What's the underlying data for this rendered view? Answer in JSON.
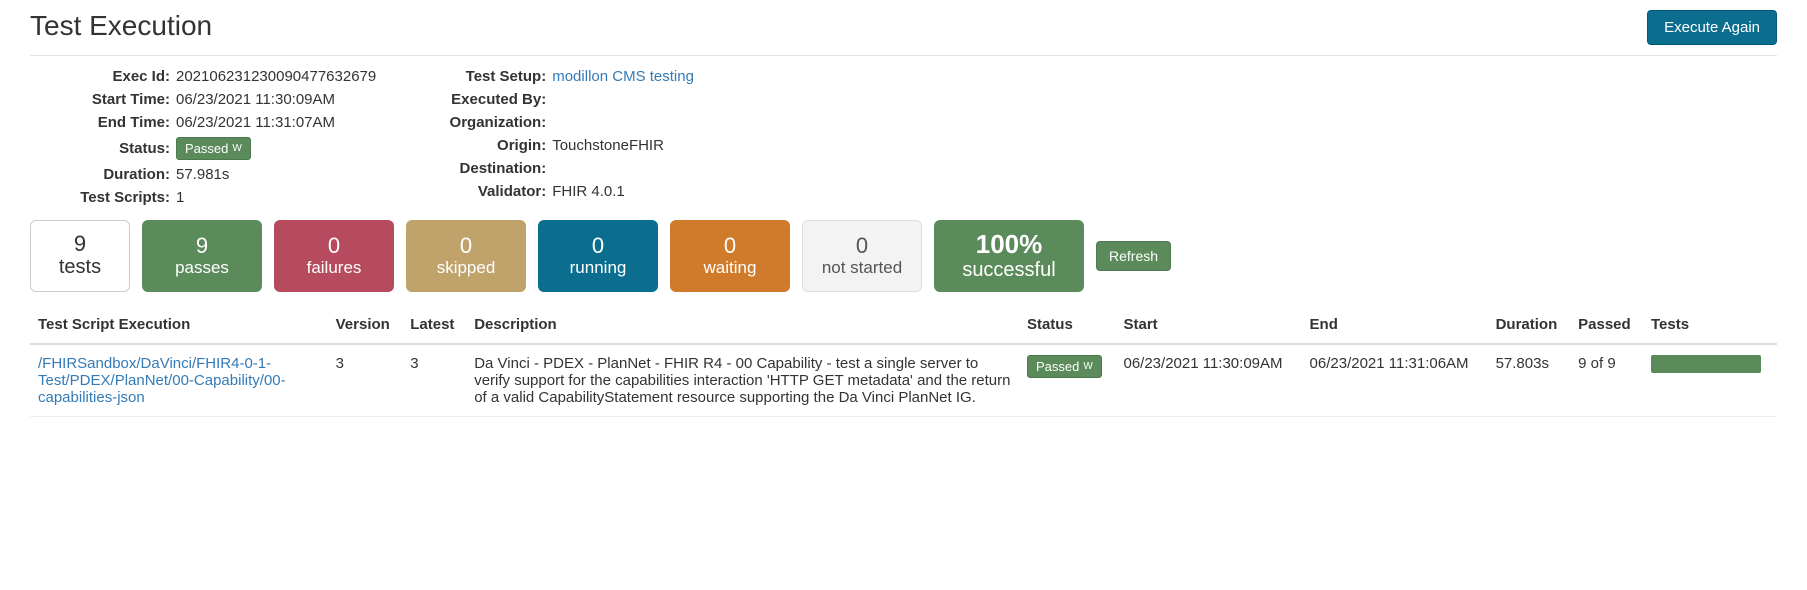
{
  "page": {
    "title": "Test Execution",
    "execute_again": "Execute Again"
  },
  "meta_left": {
    "exec_id_label": "Exec Id:",
    "exec_id": "20210623123009047763​2679",
    "start_label": "Start Time:",
    "start": "06/23/2021 11:30:09AM",
    "end_label": "End Time:",
    "end": "06/23/2021 11:31:07AM",
    "status_label": "Status:",
    "status_badge": "Passed",
    "status_sup": "W",
    "duration_label": "Duration:",
    "duration": "57.981s",
    "scripts_label": "Test Scripts:",
    "scripts": "1"
  },
  "meta_right": {
    "setup_label": "Test Setup:",
    "setup_link": "modillon CMS testing",
    "execby_label": "Executed By:",
    "execby": "",
    "org_label": "Organization:",
    "org": "",
    "origin_label": "Origin:",
    "origin": "TouchstoneFHIR",
    "dest_label": "Destination:",
    "dest": "",
    "validator_label": "Validator:",
    "validator": "FHIR 4.0.1"
  },
  "tiles": {
    "tests_n": "9",
    "tests_l": "tests",
    "pass_n": "9",
    "pass_l": "passes",
    "fail_n": "0",
    "fail_l": "failures",
    "skip_n": "0",
    "skip_l": "skipped",
    "run_n": "0",
    "run_l": "running",
    "wait_n": "0",
    "wait_l": "waiting",
    "nost_n": "0",
    "nost_l": "not started",
    "succ_n": "100%",
    "succ_l": "successful",
    "refresh": "Refresh"
  },
  "table": {
    "headers": {
      "script": "Test Script Execution",
      "version": "Version",
      "latest": "Latest",
      "desc": "Description",
      "status": "Status",
      "start": "Start",
      "end": "End",
      "duration": "Duration",
      "passed": "Passed",
      "tests": "Tests"
    },
    "row": {
      "script": "/FHIRSandbox/DaVinci/FHIR4-0-1-Test/PDEX/PlanNet/00-Capability/00-capabilities-json",
      "version": "3",
      "latest": "3",
      "desc": "Da Vinci - PDEX - PlanNet - FHIR R4 - 00 Capability - test a single server to verify support for the capabilities interaction 'HTTP GET metadata' and the return of a valid CapabilityStatement resource supporting the Da Vinci PlanNet IG.",
      "status_badge": "Passed",
      "status_sup": "W",
      "start": "06/23/2021 11:30:09AM",
      "end": "06/23/2021 11:31:06AM",
      "duration": "57.803s",
      "passed": "9 of 9"
    }
  }
}
